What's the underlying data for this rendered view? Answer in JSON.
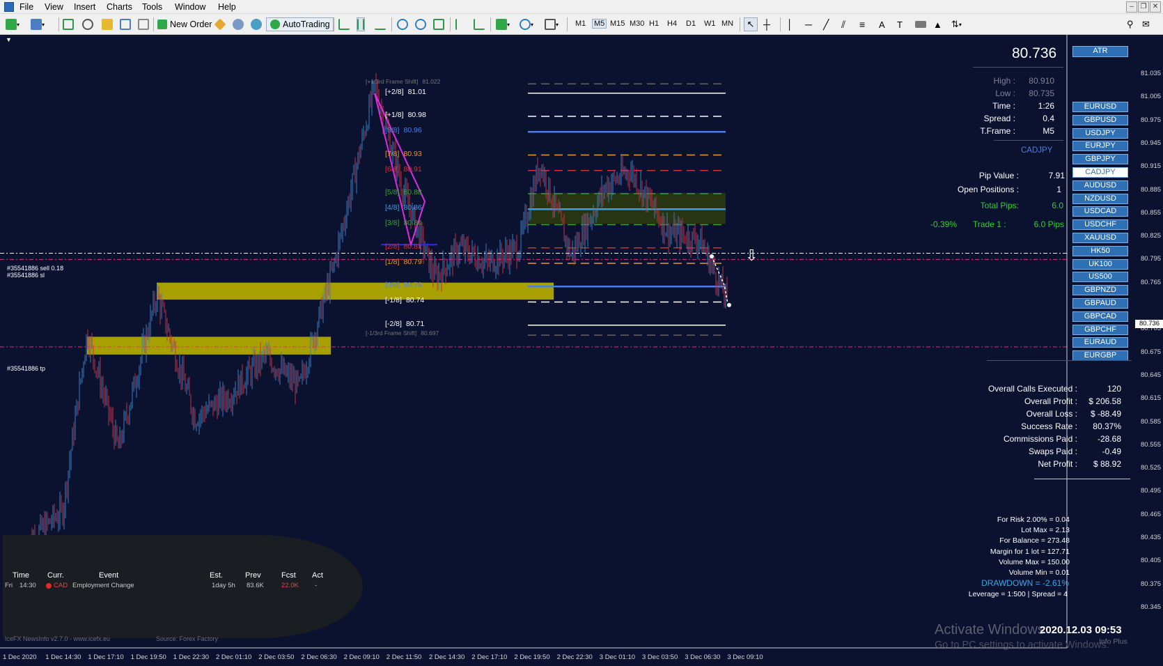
{
  "menu": {
    "items": [
      "File",
      "View",
      "Insert",
      "Charts",
      "Tools",
      "Window",
      "Help"
    ]
  },
  "toolbar": {
    "new_order": "New Order",
    "autotrading": "AutoTrading",
    "timeframes": [
      "M1",
      "M5",
      "M15",
      "M30",
      "H1",
      "H4",
      "D1",
      "W1",
      "MN"
    ]
  },
  "chart": {
    "price_scale": [
      "81.035",
      "81.005",
      "80.975",
      "80.945",
      "80.915",
      "80.885",
      "80.855",
      "80.825",
      "80.795",
      "80.765",
      "80.736",
      "80.705",
      "80.675",
      "80.645",
      "80.615",
      "80.585",
      "80.555",
      "80.525",
      "80.495",
      "80.465",
      "80.435",
      "80.405",
      "80.375",
      "80.345"
    ],
    "time_scale": [
      "1 Dec 2020",
      "1 Dec 14:30",
      "1 Dec 17:10",
      "1 Dec 19:50",
      "1 Dec 22:30",
      "2 Dec 01:10",
      "2 Dec 03:50",
      "2 Dec 06:30",
      "2 Dec 09:10",
      "2 Dec 11:50",
      "2 Dec 14:30",
      "2 Dec 17:10",
      "2 Dec 19:50",
      "2 Dec 22:30",
      "3 Dec 01:10",
      "3 Dec 03:50",
      "3 Dec 06:30",
      "3 Dec 09:10"
    ],
    "murrey_levels": [
      {
        "label": "[+1/3rd Frame Shift]",
        "value": "81.022",
        "color": "#777777"
      },
      {
        "label": "[+2/8]",
        "value": "81.01",
        "color": "#ffffff"
      },
      {
        "label": "[+1/8]",
        "value": "80.98",
        "color": "#ffffff"
      },
      {
        "label": "[8/8]",
        "value": "80.96",
        "color": "#4a7fe8"
      },
      {
        "label": "[7/8]",
        "value": "80.93",
        "color": "#e89a2a"
      },
      {
        "label": "[6/8]",
        "value": "80.91",
        "color": "#d0303a"
      },
      {
        "label": "[5/8]",
        "value": "80.88",
        "color": "#3aa03a"
      },
      {
        "label": "[4/8]",
        "value": "80.86",
        "color": "#3aa0e8"
      },
      {
        "label": "[3/8]",
        "value": "80.84",
        "color": "#3aa03a"
      },
      {
        "label": "[2/8]",
        "value": "80.81",
        "color": "#d0303a"
      },
      {
        "label": "[1/8]",
        "value": "80.79",
        "color": "#e89a2a"
      },
      {
        "label": "[0/8]",
        "value": "80.76",
        "color": "#4a7fe8"
      },
      {
        "label": "[-1/8]",
        "value": "80.74",
        "color": "#ffffff"
      },
      {
        "label": "[-2/8]",
        "value": "80.71",
        "color": "#ffffff"
      },
      {
        "label": "[-1/3rd Frame Shift]",
        "value": "80.697",
        "color": "#777777"
      }
    ],
    "trade_labels": {
      "sell": "#35541886 sell 0.18",
      "sl": "#35541886 sl",
      "tp": "#35541886 tp"
    },
    "current_price_tag": "80.736",
    "watermark": {
      "line1": "Activate Windows",
      "line2": "Go to PC settings to activate Windows."
    },
    "datetime": "2020.12.03 09:53",
    "info_plus": "Info Plus",
    "down_arrow": "⇩"
  },
  "panel": {
    "price": "80.736",
    "atr_button": "ATR",
    "stats": [
      {
        "label": "High :",
        "value": "80.910",
        "dim": true
      },
      {
        "label": "Low :",
        "value": "80.735",
        "dim": true
      },
      {
        "label": "Time :",
        "value": "1:26"
      },
      {
        "label": "Spread :",
        "value": "0.4"
      },
      {
        "label": "T.Frame :",
        "value": "M5"
      }
    ],
    "symbol": "CADJPY",
    "pip_value_label": "Pip Value :",
    "pip_value": "7.91",
    "open_positions_label": "Open Positions :",
    "open_positions": "1",
    "total_pips_label": "Total Pips:",
    "total_pips": "6.0",
    "trade_pct": "-0.39%",
    "trade_label": "Trade 1 :",
    "trade_pips": "6.0 Pips",
    "symbols": [
      "EURUSD",
      "GBPUSD",
      "USDJPY",
      "EURJPY",
      "GBPJPY",
      "CADJPY",
      "AUDUSD",
      "NZDUSD",
      "USDCAD",
      "USDCHF",
      "XAUUSD",
      "HK50",
      "UK100",
      "US500",
      "GBPNZD",
      "GBPAUD",
      "GBPCAD",
      "GBPCHF",
      "EURAUD",
      "EURGBP"
    ],
    "active_symbol": "CADJPY",
    "overall": [
      {
        "label": "Overall Calls Executed :",
        "value": "120"
      },
      {
        "label": "Overall Profit :",
        "value": "$ 206.58"
      },
      {
        "label": "Overall Loss :",
        "value": "$ -88.49"
      },
      {
        "label": "Success Rate :",
        "value": "80.37%"
      },
      {
        "label": "Commissions Paid :",
        "value": "-28.68"
      },
      {
        "label": "Swaps Paid :",
        "value": "-0.49"
      },
      {
        "label": "Net Profit :",
        "value": "$ 88.92"
      }
    ],
    "risk": [
      "For Risk 2.00% = 0.04",
      "Lot Max = 2.13",
      "For Balance = 273.48",
      "Margin for 1 lot = 127.71",
      "Volume Max = 150.00",
      "Volume Min = 0.01"
    ],
    "drawdown": "DRAWDOWN = -2.61%",
    "leverage": "Leverage = 1:500 | Spread = 4"
  },
  "news": {
    "headers": [
      "Time",
      "Curr.",
      "Event",
      "Est.",
      "Prev",
      "Fcst",
      "Act"
    ],
    "row": {
      "day": "Fri",
      "time": "14:30",
      "curr": "CAD",
      "event": "Employment Change",
      "est": "1day 5h",
      "prev": "83.6K",
      "fcst": "22.0K",
      "act": "-"
    },
    "footer_left": "IceFX NewsInfo v2.7.0  -  www.icefx.eu",
    "footer_right": "Source: Forex Factory"
  },
  "colors": {
    "bg": "#0a1230",
    "bull": "#3a7fc4",
    "bear": "#c43040",
    "zone": "#a8a000",
    "accent": "#2f6fb3"
  }
}
